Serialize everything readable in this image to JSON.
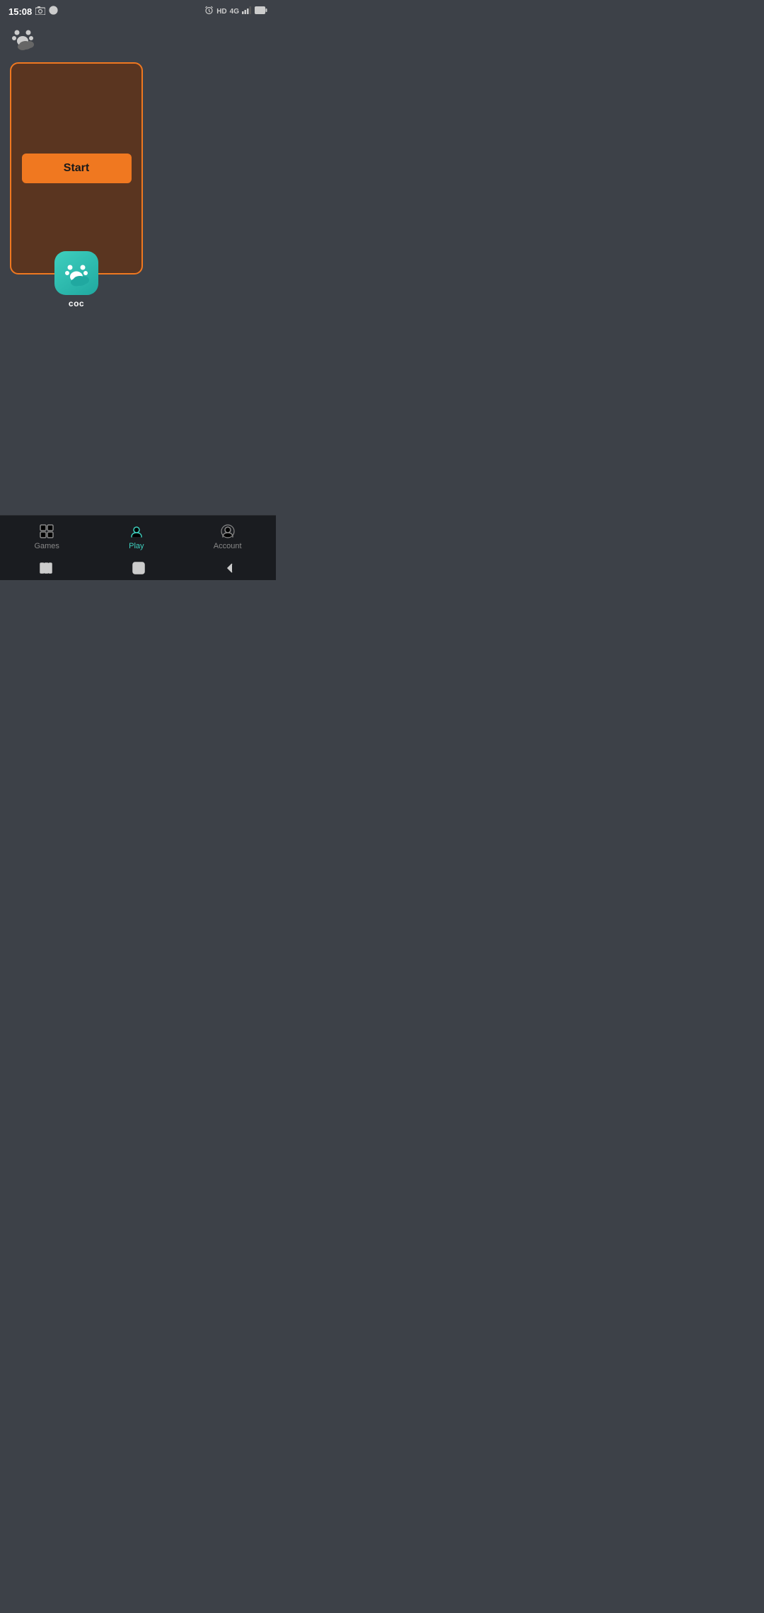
{
  "status_bar": {
    "time": "15:08",
    "icons_left": [
      "photo-icon",
      "clock-icon"
    ],
    "icons_right": [
      "alarm-icon",
      "hd-label",
      "4g-label",
      "signal-icon",
      "battery-icon"
    ],
    "hd_text": "HD",
    "4g_text": "4G"
  },
  "header": {
    "logo_alt": "paw-cloud-logo"
  },
  "game_card": {
    "start_button_label": "Start",
    "app_name": "coc"
  },
  "bottom_nav": {
    "items": [
      {
        "id": "games",
        "label": "Games",
        "active": false
      },
      {
        "id": "play",
        "label": "Play",
        "active": true
      },
      {
        "id": "account",
        "label": "Account",
        "active": false
      }
    ]
  },
  "colors": {
    "accent_orange": "#f07820",
    "accent_teal": "#3ecfbe",
    "card_bg": "#5a3520",
    "bg": "#3d4148",
    "nav_bg": "#1a1c20"
  }
}
